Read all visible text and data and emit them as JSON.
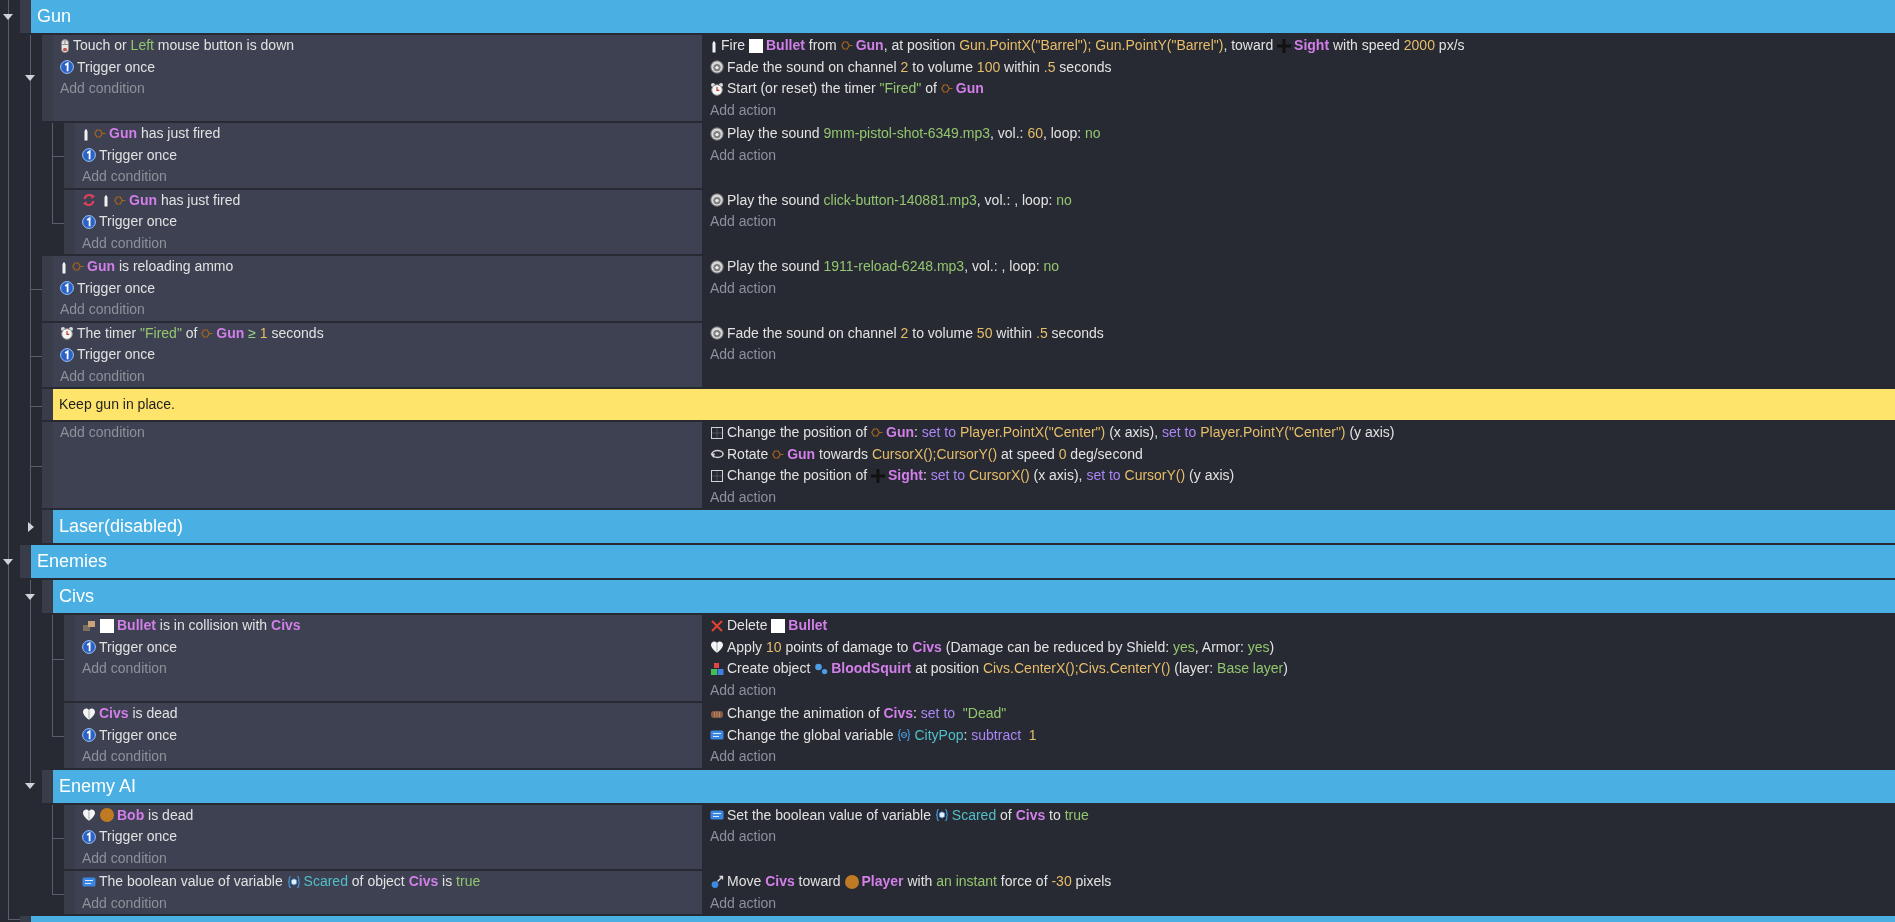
{
  "events": [
    {
      "kind": "group",
      "title": "Gun",
      "expanded": true,
      "children": [
        {
          "kind": "event",
          "expanded": true,
          "conditions": [
            {
              "kind": "mouse",
              "inverted": false,
              "parts": [
                {
                  "kind": "text",
                  "text": "Touch or "
                },
                {
                  "kind": "string",
                  "text": "Left"
                },
                {
                  "kind": "text",
                  "text": " mouse button is down"
                }
              ]
            },
            {
              "kind": "trigger",
              "inverted": false,
              "parts": [
                {
                  "kind": "text",
                  "text": "Trigger once"
                }
              ]
            }
          ],
          "add_condition": "Add condition",
          "actions": [
            {
              "kind": "bullet",
              "parts": [
                {
                  "kind": "text",
                  "text": "Fire "
                },
                {
                  "kind": "square"
                },
                {
                  "kind": "object",
                  "text": "Bullet"
                },
                {
                  "kind": "text",
                  "text": " from "
                },
                {
                  "kind": "hexagon"
                },
                {
                  "kind": "object",
                  "text": "Gun"
                },
                {
                  "kind": "text",
                  "text": ", at position "
                },
                {
                  "kind": "number",
                  "text": "Gun.PointX(\"Barrel\"); Gun.PointY(\"Barrel\")"
                },
                {
                  "kind": "text",
                  "text": ", toward "
                },
                {
                  "kind": "crosshair"
                },
                {
                  "kind": "object",
                  "text": "Sight"
                },
                {
                  "kind": "text",
                  "text": " with speed "
                },
                {
                  "kind": "number",
                  "text": "2000"
                },
                {
                  "kind": "text",
                  "text": " px/s"
                }
              ]
            },
            {
              "kind": "sound",
              "parts": [
                {
                  "kind": "text",
                  "text": "Fade the sound on channel "
                },
                {
                  "kind": "number",
                  "text": "2"
                },
                {
                  "kind": "text",
                  "text": " to volume "
                },
                {
                  "kind": "number",
                  "text": "100"
                },
                {
                  "kind": "text",
                  "text": " within "
                },
                {
                  "kind": "number",
                  "text": ".5"
                },
                {
                  "kind": "text",
                  "text": " seconds"
                }
              ]
            },
            {
              "kind": "timer",
              "parts": [
                {
                  "kind": "text",
                  "text": "Start (or reset) the timer "
                },
                {
                  "kind": "string",
                  "text": "\"Fired\""
                },
                {
                  "kind": "text",
                  "text": " of "
                },
                {
                  "kind": "hexagon"
                },
                {
                  "kind": "object",
                  "text": "Gun"
                }
              ]
            }
          ],
          "add_action": "Add action",
          "children": [
            {
              "kind": "event",
              "conditions": [
                {
                  "kind": "bullet",
                  "inverted": false,
                  "parts": [
                    {
                      "kind": "hexagon"
                    },
                    {
                      "kind": "object",
                      "text": "Gun"
                    },
                    {
                      "kind": "text",
                      "text": " has just fired"
                    }
                  ]
                },
                {
                  "kind": "trigger",
                  "inverted": false,
                  "parts": [
                    {
                      "kind": "text",
                      "text": "Trigger once"
                    }
                  ]
                }
              ],
              "add_condition": "Add condition",
              "actions": [
                {
                  "kind": "sound",
                  "parts": [
                    {
                      "kind": "text",
                      "text": "Play the sound "
                    },
                    {
                      "kind": "string",
                      "text": "9mm-pistol-shot-6349.mp3"
                    },
                    {
                      "kind": "text",
                      "text": ", vol.: "
                    },
                    {
                      "kind": "number",
                      "text": "60"
                    },
                    {
                      "kind": "text",
                      "text": ", loop: "
                    },
                    {
                      "kind": "string",
                      "text": "no"
                    }
                  ]
                }
              ],
              "add_action": "Add action"
            },
            {
              "kind": "event",
              "conditions": [
                {
                  "kind": "bullet",
                  "inverted": true,
                  "parts": [
                    {
                      "kind": "hexagon"
                    },
                    {
                      "kind": "object",
                      "text": "Gun"
                    },
                    {
                      "kind": "text",
                      "text": " has just fired"
                    }
                  ]
                },
                {
                  "kind": "trigger",
                  "inverted": false,
                  "parts": [
                    {
                      "kind": "text",
                      "text": "Trigger once"
                    }
                  ]
                }
              ],
              "add_condition": "Add condition",
              "actions": [
                {
                  "kind": "sound",
                  "parts": [
                    {
                      "kind": "text",
                      "text": "Play the sound "
                    },
                    {
                      "kind": "string",
                      "text": "click-button-140881.mp3"
                    },
                    {
                      "kind": "text",
                      "text": ", vol.: , loop: "
                    },
                    {
                      "kind": "string",
                      "text": "no"
                    }
                  ]
                }
              ],
              "add_action": "Add action"
            }
          ]
        },
        {
          "kind": "event",
          "conditions": [
            {
              "kind": "bullet",
              "inverted": false,
              "parts": [
                {
                  "kind": "hexagon"
                },
                {
                  "kind": "object",
                  "text": "Gun"
                },
                {
                  "kind": "text",
                  "text": " is reloading ammo"
                }
              ]
            },
            {
              "kind": "trigger",
              "inverted": false,
              "parts": [
                {
                  "kind": "text",
                  "text": "Trigger once"
                }
              ]
            }
          ],
          "add_condition": "Add condition",
          "actions": [
            {
              "kind": "sound",
              "parts": [
                {
                  "kind": "text",
                  "text": "Play the sound "
                },
                {
                  "kind": "string",
                  "text": "1911-reload-6248.mp3"
                },
                {
                  "kind": "text",
                  "text": ", vol.: , loop: "
                },
                {
                  "kind": "string",
                  "text": "no"
                }
              ]
            }
          ],
          "add_action": "Add action"
        },
        {
          "kind": "event",
          "conditions": [
            {
              "kind": "timer",
              "inverted": false,
              "parts": [
                {
                  "kind": "text",
                  "text": "The timer "
                },
                {
                  "kind": "string",
                  "text": "\"Fired\""
                },
                {
                  "kind": "text",
                  "text": " of "
                },
                {
                  "kind": "hexagon"
                },
                {
                  "kind": "object",
                  "text": "Gun"
                },
                {
                  "kind": "operator",
                  "text": " ≥"
                },
                {
                  "kind": "number",
                  "text": " 1"
                },
                {
                  "kind": "text",
                  "text": " seconds"
                }
              ]
            },
            {
              "kind": "trigger",
              "inverted": false,
              "parts": [
                {
                  "kind": "text",
                  "text": "Trigger once"
                }
              ]
            }
          ],
          "add_condition": "Add condition",
          "actions": [
            {
              "kind": "sound",
              "parts": [
                {
                  "kind": "text",
                  "text": "Fade the sound on channel "
                },
                {
                  "kind": "number",
                  "text": "2"
                },
                {
                  "kind": "text",
                  "text": " to volume "
                },
                {
                  "kind": "number",
                  "text": "50"
                },
                {
                  "kind": "text",
                  "text": " within "
                },
                {
                  "kind": "number",
                  "text": ".5"
                },
                {
                  "kind": "text",
                  "text": " seconds"
                }
              ]
            }
          ],
          "add_action": "Add action"
        },
        {
          "kind": "comment",
          "text": "Keep gun in place."
        },
        {
          "kind": "event",
          "add_condition": "Add condition",
          "actions": [
            {
              "kind": "position",
              "parts": [
                {
                  "kind": "text",
                  "text": "Change the position of "
                },
                {
                  "kind": "hexagon"
                },
                {
                  "kind": "object",
                  "text": "Gun"
                },
                {
                  "kind": "text",
                  "text": ": "
                },
                {
                  "kind": "keyword",
                  "text": "set to"
                },
                {
                  "kind": "number",
                  "text": " Player.PointX(\"Center\")"
                },
                {
                  "kind": "text",
                  "text": " (x axis), "
                },
                {
                  "kind": "keyword",
                  "text": "set to"
                },
                {
                  "kind": "number",
                  "text": " Player.PointY(\"Center\")"
                },
                {
                  "kind": "text",
                  "text": " (y axis)"
                }
              ]
            },
            {
              "kind": "rotate",
              "parts": [
                {
                  "kind": "text",
                  "text": "Rotate "
                },
                {
                  "kind": "hexagon"
                },
                {
                  "kind": "object",
                  "text": "Gun"
                },
                {
                  "kind": "text",
                  "text": " towards "
                },
                {
                  "kind": "number",
                  "text": "CursorX();CursorY()"
                },
                {
                  "kind": "text",
                  "text": " at speed "
                },
                {
                  "kind": "number",
                  "text": "0"
                },
                {
                  "kind": "text",
                  "text": " deg/second"
                }
              ]
            },
            {
              "kind": "position",
              "parts": [
                {
                  "kind": "text",
                  "text": "Change the position of "
                },
                {
                  "kind": "crosshair"
                },
                {
                  "kind": "object",
                  "text": "Sight"
                },
                {
                  "kind": "text",
                  "text": ": "
                },
                {
                  "kind": "keyword",
                  "text": "set to"
                },
                {
                  "kind": "number",
                  "text": " CursorX()"
                },
                {
                  "kind": "text",
                  "text": " (x axis), "
                },
                {
                  "kind": "keyword",
                  "text": "set to"
                },
                {
                  "kind": "number",
                  "text": " CursorY()"
                },
                {
                  "kind": "text",
                  "text": " (y axis)"
                }
              ]
            }
          ],
          "add_action": "Add action"
        },
        {
          "kind": "group",
          "title": "Laser(disabled)",
          "expanded": false
        }
      ]
    },
    {
      "kind": "group",
      "title": "Enemies",
      "expanded": true,
      "children": [
        {
          "kind": "group",
          "title": "Civs",
          "expanded": true,
          "children": [
            {
              "kind": "event",
              "conditions": [
                {
                  "kind": "collision",
                  "inverted": false,
                  "parts": [
                    {
                      "kind": "square"
                    },
                    {
                      "kind": "object",
                      "text": "Bullet"
                    },
                    {
                      "kind": "text",
                      "text": " is in collision with "
                    },
                    {
                      "kind": "object",
                      "text": "Civs"
                    }
                  ]
                },
                {
                  "kind": "trigger",
                  "inverted": false,
                  "parts": [
                    {
                      "kind": "text",
                      "text": "Trigger once"
                    }
                  ]
                }
              ],
              "add_condition": "Add condition",
              "actions": [
                {
                  "kind": "delete",
                  "parts": [
                    {
                      "kind": "text",
                      "text": "Delete "
                    },
                    {
                      "kind": "square"
                    },
                    {
                      "kind": "object",
                      "text": "Bullet"
                    }
                  ]
                },
                {
                  "kind": "health",
                  "parts": [
                    {
                      "kind": "text",
                      "text": "Apply "
                    },
                    {
                      "kind": "number",
                      "text": "10"
                    },
                    {
                      "kind": "text",
                      "text": " points of damage to "
                    },
                    {
                      "kind": "object",
                      "text": "Civs"
                    },
                    {
                      "kind": "text",
                      "text": " (Damage can be reduced by Shield: "
                    },
                    {
                      "kind": "string",
                      "text": "yes"
                    },
                    {
                      "kind": "text",
                      "text": ", Armor: "
                    },
                    {
                      "kind": "string",
                      "text": "yes"
                    },
                    {
                      "kind": "text",
                      "text": ")"
                    }
                  ]
                },
                {
                  "kind": "create",
                  "parts": [
                    {
                      "kind": "text",
                      "text": "Create object "
                    },
                    {
                      "kind": "dots"
                    },
                    {
                      "kind": "object",
                      "text": "BloodSquirt"
                    },
                    {
                      "kind": "text",
                      "text": " at position "
                    },
                    {
                      "kind": "number",
                      "text": "Civs.CenterX();Civs.CenterY()"
                    },
                    {
                      "kind": "text",
                      "text": " (layer: "
                    },
                    {
                      "kind": "string",
                      "text": "Base layer"
                    },
                    {
                      "kind": "text",
                      "text": ")"
                    }
                  ]
                }
              ],
              "add_action": "Add action"
            },
            {
              "kind": "event",
              "conditions": [
                {
                  "kind": "health",
                  "inverted": false,
                  "parts": [
                    {
                      "kind": "object",
                      "text": "Civs"
                    },
                    {
                      "kind": "text",
                      "text": " is dead"
                    }
                  ]
                },
                {
                  "kind": "trigger",
                  "inverted": false,
                  "parts": [
                    {
                      "kind": "text",
                      "text": "Trigger once"
                    }
                  ]
                }
              ],
              "add_condition": "Add condition",
              "actions": [
                {
                  "kind": "animation",
                  "parts": [
                    {
                      "kind": "text",
                      "text": "Change the animation of "
                    },
                    {
                      "kind": "object",
                      "text": "Civs"
                    },
                    {
                      "kind": "text",
                      "text": ": "
                    },
                    {
                      "kind": "keyword",
                      "text": "set to"
                    },
                    {
                      "kind": "string",
                      "text": "  \"Dead\""
                    }
                  ]
                },
                {
                  "kind": "variable",
                  "parts": [
                    {
                      "kind": "text",
                      "text": "Change the global variable "
                    },
                    {
                      "kind": "globe"
                    },
                    {
                      "kind": "variable",
                      "text": "CityPop"
                    },
                    {
                      "kind": "text",
                      "text": ": "
                    },
                    {
                      "kind": "keyword",
                      "text": "subtract"
                    },
                    {
                      "kind": "number",
                      "text": "  1"
                    }
                  ]
                }
              ],
              "add_action": "Add action"
            }
          ]
        },
        {
          "kind": "group",
          "title": "Enemy AI",
          "expanded": true,
          "children": [
            {
              "kind": "event",
              "conditions": [
                {
                  "kind": "health",
                  "inverted": false,
                  "parts": [
                    {
                      "kind": "disc"
                    },
                    {
                      "kind": "object",
                      "text": "Bob"
                    },
                    {
                      "kind": "text",
                      "text": " is dead"
                    }
                  ]
                },
                {
                  "kind": "trigger",
                  "inverted": false,
                  "parts": [
                    {
                      "kind": "text",
                      "text": "Trigger once"
                    }
                  ]
                }
              ],
              "add_condition": "Add condition",
              "actions": [
                {
                  "kind": "variable",
                  "parts": [
                    {
                      "kind": "text",
                      "text": "Set the boolean value of variable "
                    },
                    {
                      "kind": "cube"
                    },
                    {
                      "kind": "variable",
                      "text": "Scared"
                    },
                    {
                      "kind": "text",
                      "text": " of "
                    },
                    {
                      "kind": "object",
                      "text": "Civs"
                    },
                    {
                      "kind": "text",
                      "text": " to "
                    },
                    {
                      "kind": "string",
                      "text": "true"
                    }
                  ]
                }
              ],
              "add_action": "Add action"
            },
            {
              "kind": "event",
              "conditions": [
                {
                  "kind": "variable",
                  "inverted": false,
                  "parts": [
                    {
                      "kind": "text",
                      "text": "The boolean value of variable "
                    },
                    {
                      "kind": "cube"
                    },
                    {
                      "kind": "variable",
                      "text": "Scared"
                    },
                    {
                      "kind": "text",
                      "text": " of object "
                    },
                    {
                      "kind": "object",
                      "text": "Civs"
                    },
                    {
                      "kind": "text",
                      "text": " is "
                    },
                    {
                      "kind": "string",
                      "text": "true"
                    }
                  ]
                }
              ],
              "add_condition": "Add condition",
              "actions": [
                {
                  "kind": "force",
                  "parts": [
                    {
                      "kind": "text",
                      "text": "Move "
                    },
                    {
                      "kind": "object",
                      "text": "Civs"
                    },
                    {
                      "kind": "text",
                      "text": " toward "
                    },
                    {
                      "kind": "disc"
                    },
                    {
                      "kind": "object",
                      "text": "Player"
                    },
                    {
                      "kind": "text",
                      "text": " with "
                    },
                    {
                      "kind": "string",
                      "text": "an instant"
                    },
                    {
                      "kind": "text",
                      "text": " force of "
                    },
                    {
                      "kind": "number",
                      "text": "-30"
                    },
                    {
                      "kind": "text",
                      "text": " pixels"
                    }
                  ]
                }
              ],
              "add_action": "Add action"
            }
          ]
        }
      ]
    },
    {
      "kind": "group"
    }
  ]
}
